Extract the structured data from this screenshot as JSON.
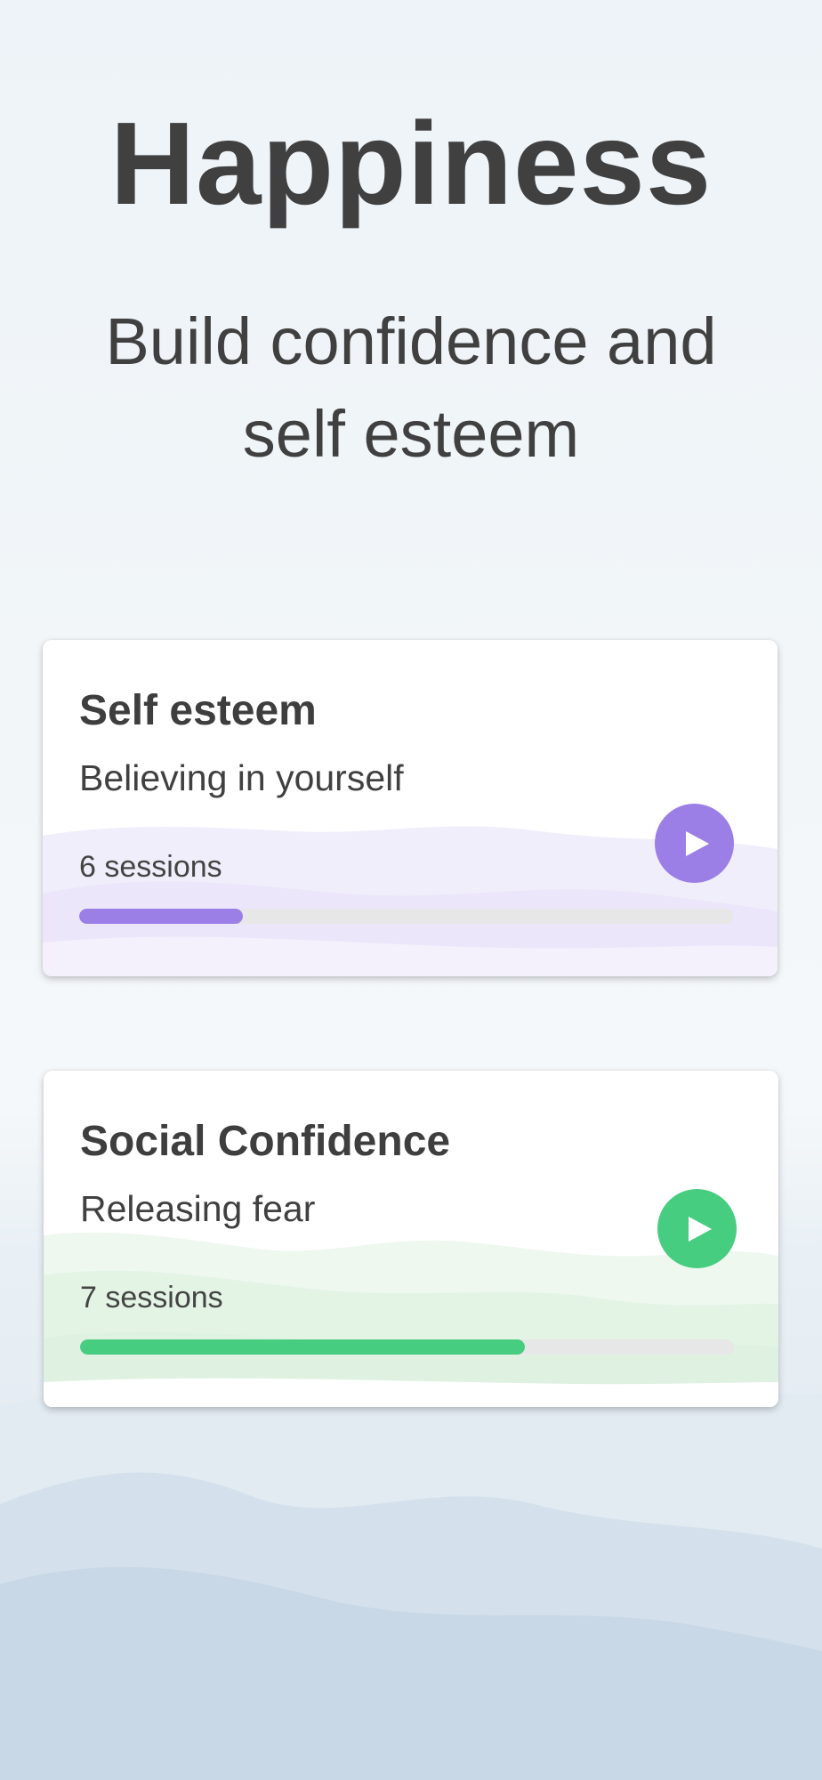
{
  "header": {
    "title": "Happiness",
    "subtitle": "Build confidence and self esteem"
  },
  "courses": [
    {
      "title": "Self esteem",
      "description": "Believing in yourself",
      "sessions_label": "6 sessions",
      "progress": 0.25,
      "accent_color": "#9b7fe6",
      "play_icon": "play-icon"
    },
    {
      "title": "Social Confidence",
      "description": "Releasing fear",
      "sessions_label": "7 sessions",
      "progress": 0.68,
      "accent_color": "#47cd80",
      "play_icon": "play-icon"
    }
  ],
  "colors": {
    "text": "#404040",
    "track": "#e7e7e7",
    "card": "#ffffff"
  }
}
